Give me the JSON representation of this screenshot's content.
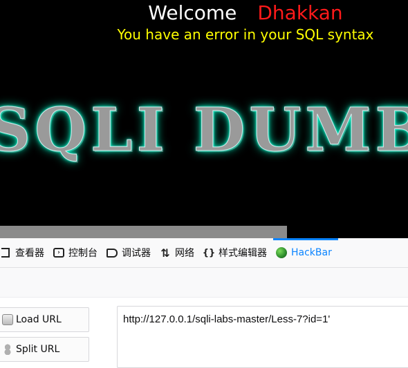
{
  "page": {
    "welcome_label": "Welcome",
    "user_name": "Dhakkan",
    "error_message": "You have an error in your SQL syntax",
    "banner_text": "SQLI DUMB"
  },
  "devtools": {
    "tabs": [
      {
        "label": "查看器",
        "icon": "inspector-icon"
      },
      {
        "label": "控制台",
        "icon": "console-icon"
      },
      {
        "label": "调试器",
        "icon": "debugger-icon"
      },
      {
        "label": "网络",
        "icon": "network-icon"
      },
      {
        "label": "样式编辑器",
        "icon": "style-editor-icon"
      },
      {
        "label": "HackBar",
        "icon": "hackbar-icon",
        "active": true
      }
    ]
  },
  "hackbar": {
    "load_url_label": "Load URL",
    "split_url_label": "Split URL",
    "url_value": "http://127.0.0.1/sqli-labs-master/Less-7?id=1'"
  },
  "colors": {
    "accent": "#0a84ff",
    "error_text": "#ffff00",
    "user_name": "#ff1a1a",
    "banner_glow": "#00ffd0"
  }
}
